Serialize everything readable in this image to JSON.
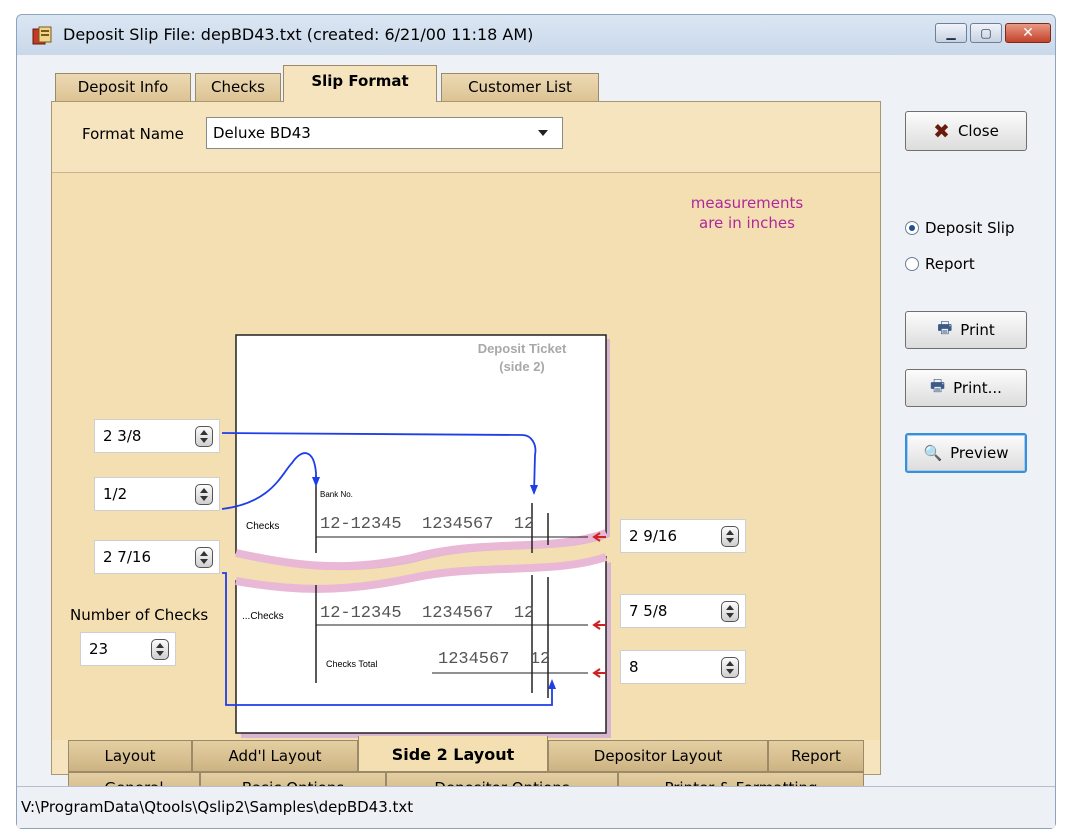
{
  "window": {
    "title": "Deposit Slip File:  depBD43.txt  (created: 6/21/00 11:18 AM)"
  },
  "top_tabs": [
    {
      "label": "Deposit Info",
      "active": false
    },
    {
      "label": "Checks",
      "active": false
    },
    {
      "label": "Slip Format",
      "active": true
    },
    {
      "label": "Customer List",
      "active": false
    }
  ],
  "format": {
    "label": "Format Name",
    "value": "Deluxe BD43"
  },
  "note": {
    "line1": "measurements",
    "line2": "are in inches"
  },
  "diagram": {
    "ticket_title": "Deposit Ticket",
    "ticket_subtitle": "(side 2)",
    "bank_no_label": "Bank No.",
    "row1_label": "Checks",
    "row1_values": "12-12345  1234567  12",
    "row2_label": "...Checks",
    "row2_values": "12-12345  1234567  12",
    "total_label": "Checks Total",
    "total_values": "1234567  12"
  },
  "fields": {
    "left_top": "2 3/8",
    "left_mid": "1/2",
    "left_bottom": "2 7/16",
    "right_top": "2 9/16",
    "right_mid": "7 5/8",
    "right_bottom": "8",
    "num_checks_label": "Number of Checks",
    "num_checks": "23"
  },
  "bottom_tabs_row1": [
    {
      "label": "Layout"
    },
    {
      "label": "Add'l Layout"
    },
    {
      "label": "Side 2 Layout",
      "active": true
    },
    {
      "label": "Depositor Layout"
    },
    {
      "label": "Report"
    }
  ],
  "bottom_tabs_row2": [
    {
      "label": "General"
    },
    {
      "label": "Basic Options"
    },
    {
      "label": "Depositor Options"
    },
    {
      "label": "Printer & Formatting"
    }
  ],
  "right_panel": {
    "close": "Close",
    "radio_deposit_slip": "Deposit Slip",
    "radio_report": "Report",
    "selected": "Deposit Slip",
    "print": "Print",
    "print_dialog": "Print...",
    "preview": "Preview"
  },
  "status": {
    "path": "V:\\ProgramData\\Qtools\\Qslip2\\Samples\\depBD43.txt"
  },
  "colors": {
    "tab_panel": "#f5e4bd",
    "note_text": "#b0279b",
    "arrow_blue": "#1f3ee8",
    "marker_red": "#cc2222"
  }
}
